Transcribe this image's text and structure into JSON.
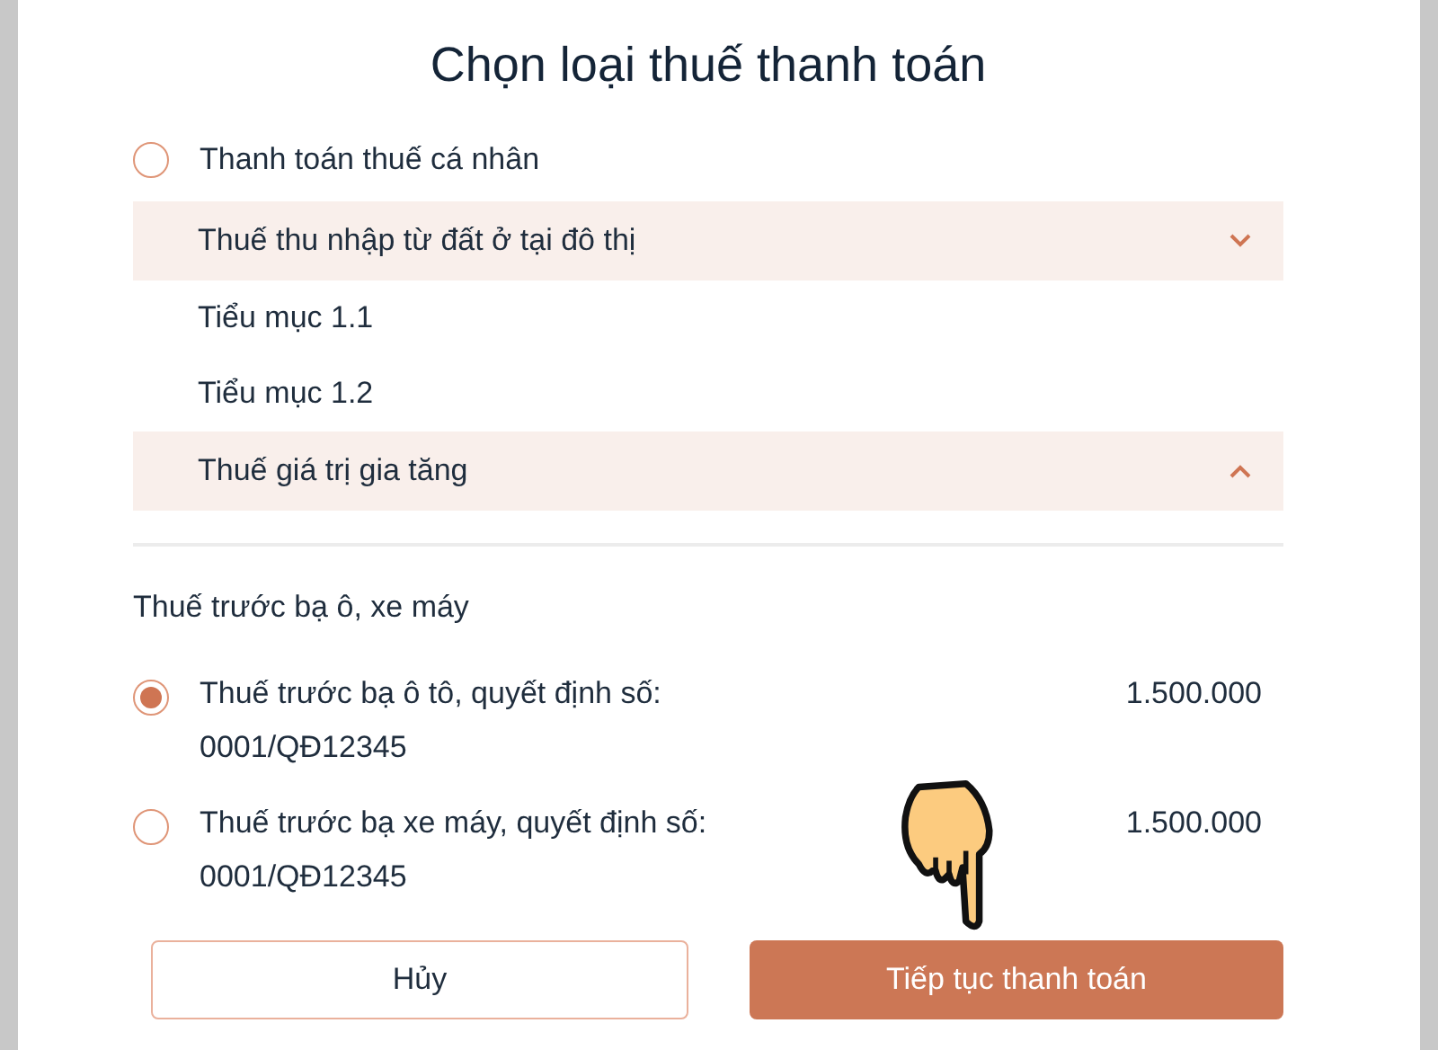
{
  "dialog": {
    "title": "Chọn loại thuế thanh toán",
    "personal": {
      "label": "Thanh toán thuế cá nhân",
      "selected": false
    },
    "groups": [
      {
        "label": "Thuế thu nhập từ đất ở tại đô thị",
        "expanded": true,
        "children": [
          {
            "label": "Tiểu mục 1.1"
          },
          {
            "label": "Tiểu mục 1.2"
          }
        ]
      },
      {
        "label": "Thuế giá trị gia tăng",
        "expanded": false
      }
    ],
    "section": {
      "heading": "Thuế trước bạ ô, xe máy",
      "options": [
        {
          "label": "Thuế trước bạ ô tô, quyết định số: 0001/QĐ12345",
          "amount": "1.500.000",
          "selected": true
        },
        {
          "label": "Thuế trước bạ xe máy, quyết định số: 0001/QĐ12345",
          "amount": "1.500.000",
          "selected": false
        }
      ]
    },
    "buttons": [
      {
        "kind": "secondary",
        "label": "Hủy"
      },
      {
        "kind": "primary",
        "label": "Tiếp tục thanh toán"
      }
    ]
  }
}
